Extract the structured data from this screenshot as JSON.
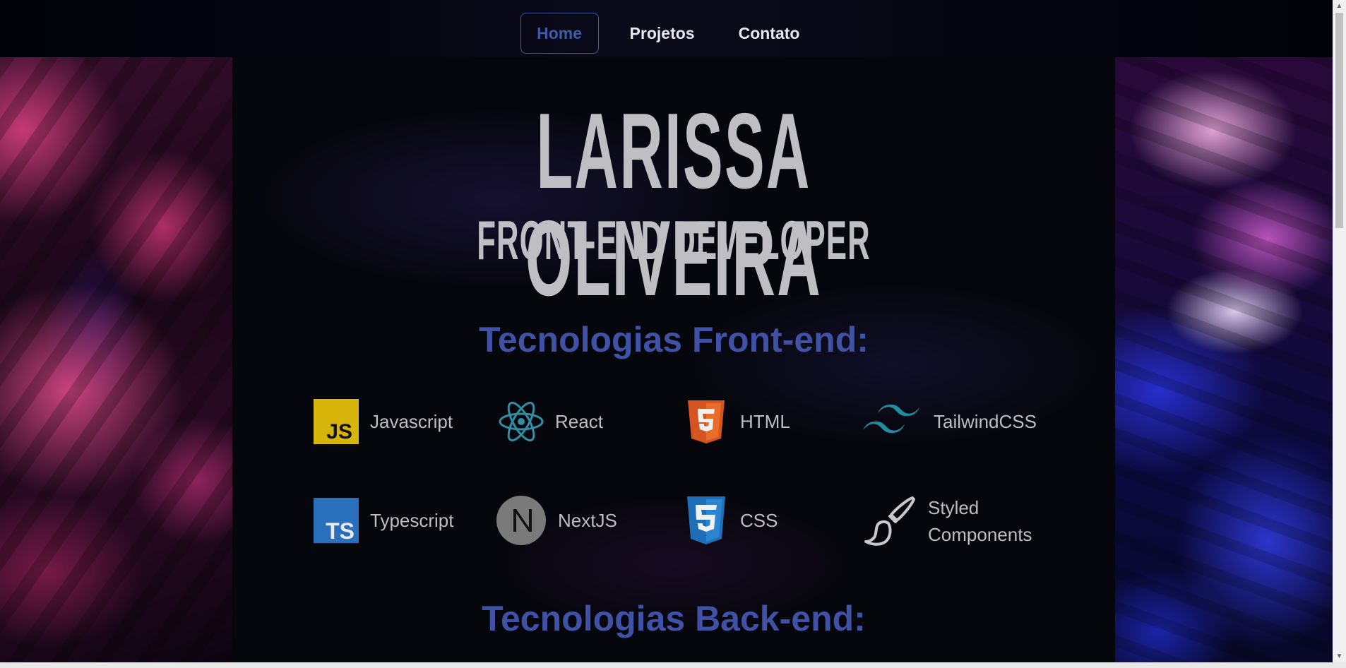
{
  "nav": {
    "items": [
      {
        "label": "Home",
        "active": true
      },
      {
        "label": "Projetos",
        "active": false
      },
      {
        "label": "Contato",
        "active": false
      }
    ]
  },
  "hero": {
    "name": "LARISSA OLIVEIRA",
    "role": "FRONT-END DEVELOPER"
  },
  "frontend": {
    "title": "Tecnologias Front-end:",
    "techs": [
      {
        "label": "Javascript",
        "icon": "javascript-icon"
      },
      {
        "label": "React",
        "icon": "react-icon"
      },
      {
        "label": "HTML",
        "icon": "html5-icon"
      },
      {
        "label": "TailwindCSS",
        "icon": "tailwind-icon"
      },
      {
        "label": "Typescript",
        "icon": "typescript-icon"
      },
      {
        "label": "NextJS",
        "icon": "nextjs-icon"
      },
      {
        "label": "CSS",
        "icon": "css3-icon"
      },
      {
        "label": "Styled Components",
        "icon": "paintbrush-icon"
      }
    ]
  },
  "backend": {
    "title": "Tecnologias Back-end:"
  },
  "colors": {
    "accent": "#3f52a6",
    "text": "#bdbdc2",
    "background": "#06060d"
  }
}
